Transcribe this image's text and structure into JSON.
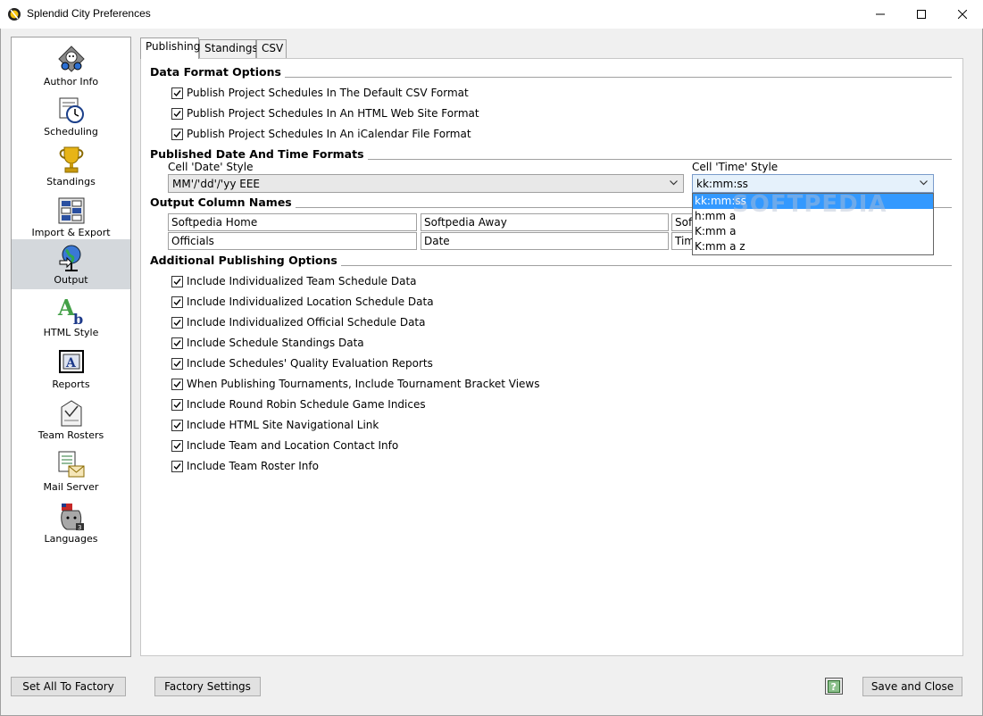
{
  "window": {
    "title": "Splendid City Preferences",
    "accent": "#3399ff"
  },
  "sidebar": {
    "items": [
      {
        "label": "Author Info",
        "icon": "author-info-icon"
      },
      {
        "label": "Scheduling",
        "icon": "scheduling-clock-icon"
      },
      {
        "label": "Standings",
        "icon": "trophy-icon"
      },
      {
        "label": "Import & Export",
        "icon": "import-export-icon"
      },
      {
        "label": "Output",
        "icon": "globe-output-icon",
        "selected": true
      },
      {
        "label": "HTML Style",
        "icon": "html-style-icon"
      },
      {
        "label": "Reports",
        "icon": "reports-icon"
      },
      {
        "label": "Team Rosters",
        "icon": "team-rosters-icon"
      },
      {
        "label": "Mail Server",
        "icon": "mail-server-icon"
      },
      {
        "label": "Languages",
        "icon": "languages-icon"
      }
    ]
  },
  "tabs": [
    {
      "label": "Publishing",
      "active": true
    },
    {
      "label": "Standings"
    },
    {
      "label": "CSV"
    }
  ],
  "publishing": {
    "data_format": {
      "title": "Data Format Options",
      "options": [
        {
          "label": "Publish Project Schedules In The Default CSV Format",
          "checked": true
        },
        {
          "label": "Publish Project Schedules In An HTML Web Site Format",
          "checked": true
        },
        {
          "label": "Publish Project Schedules In An iCalendar File Format",
          "checked": true
        }
      ]
    },
    "date_time": {
      "title": "Published Date And Time Formats",
      "date_label": "Cell 'Date' Style",
      "date_value": "MM'/'dd'/'yy  EEE",
      "time_label": "Cell 'Time' Style",
      "time_value": "kk:mm:ss",
      "time_options": [
        "kk:mm:ss",
        "h:mm a",
        "K:mm a",
        "K:mm a z"
      ],
      "time_selected": "kk:mm:ss"
    },
    "column_names": {
      "title": "Output Column Names",
      "row1": [
        "Softpedia Home",
        "Softpedia Away",
        "Soft"
      ],
      "row2": [
        "Officials",
        "Date",
        "Tim"
      ]
    },
    "additional": {
      "title": "Additional Publishing Options",
      "options": [
        {
          "label": "Include Individualized Team Schedule Data",
          "checked": true
        },
        {
          "label": "Include Individualized Location Schedule Data",
          "checked": true
        },
        {
          "label": "Include Individualized Official Schedule Data",
          "checked": true
        },
        {
          "label": "Include Schedule Standings Data",
          "checked": true
        },
        {
          "label": "Include Schedules' Quality Evaluation Reports",
          "checked": true
        },
        {
          "label": "When Publishing Tournaments, Include Tournament Bracket Views",
          "checked": true
        },
        {
          "label": "Include Round Robin Schedule Game Indices",
          "checked": true
        },
        {
          "label": "Include HTML Site Navigational Link",
          "checked": true
        },
        {
          "label": "Include Team and Location Contact Info",
          "checked": true
        },
        {
          "label": "Include Team Roster Info",
          "checked": true
        }
      ]
    }
  },
  "watermark": "SOFTPEDIA",
  "buttons": {
    "set_all_factory": "Set All To Factory",
    "factory_settings": "Factory Settings",
    "help": "?",
    "save_close": "Save and Close"
  }
}
